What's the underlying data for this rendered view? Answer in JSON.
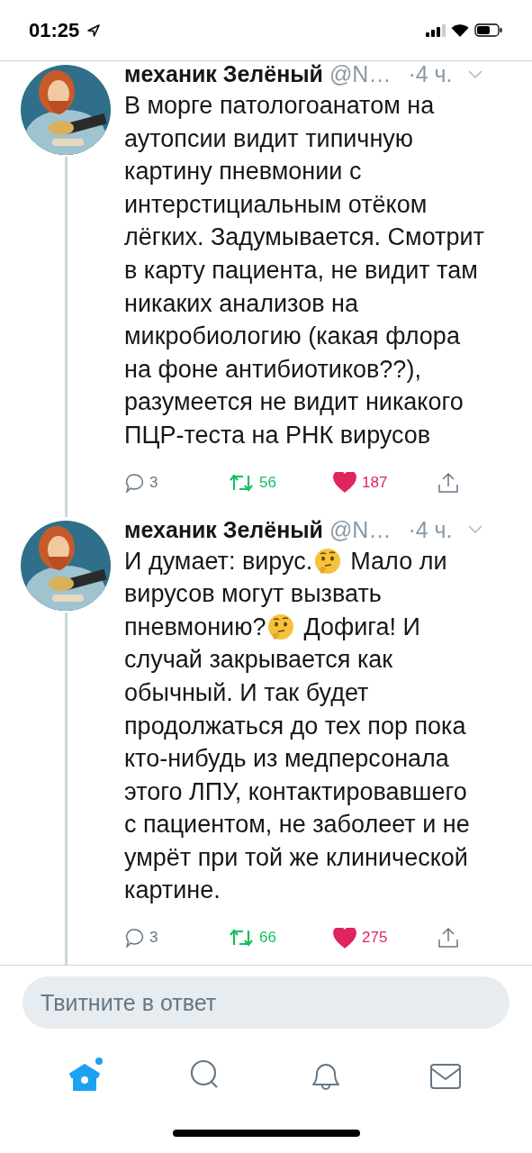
{
  "status_bar": {
    "time": "01:25"
  },
  "tweets": [
    {
      "name": "механик Зелёный",
      "handle": "@N…",
      "time": "·4 ч.",
      "lines": [
        [
          {
            "kind": "text",
            "text": "В морге патологоанатом на"
          }
        ],
        [
          {
            "kind": "text",
            "text": "аутопсии видит типичную"
          }
        ],
        [
          {
            "kind": "text",
            "text": "картину пневмонии с"
          }
        ],
        [
          {
            "kind": "text",
            "text": "интерстициальным отёком"
          }
        ],
        [
          {
            "kind": "text",
            "text": "лёгких. Задумывается. Смотрит"
          }
        ],
        [
          {
            "kind": "text",
            "text": "в карту пациента, не видит там"
          }
        ],
        [
          {
            "kind": "text",
            "text": "никаких анализов на"
          }
        ],
        [
          {
            "kind": "text",
            "text": "микробиологию (какая флора"
          }
        ],
        [
          {
            "kind": "text",
            "text": "на фоне антибиотиков??),"
          }
        ],
        [
          {
            "kind": "text",
            "text": "разумеется не видит никакого"
          }
        ],
        [
          {
            "kind": "text",
            "text": "ПЦР-теста на РНК вирусов"
          }
        ]
      ],
      "replies": "3",
      "retweets": "56",
      "likes": "187",
      "retweeted": true,
      "liked": true
    },
    {
      "name": "механик Зелёный",
      "handle": "@N…",
      "time": "·4 ч.",
      "lines": [
        [
          {
            "kind": "text",
            "text": "И думает: вирус."
          },
          {
            "kind": "emoji"
          },
          {
            "kind": "text",
            "text": "Мало ли"
          }
        ],
        [
          {
            "kind": "text",
            "text": "вирусов могут вызвать"
          }
        ],
        [
          {
            "kind": "text",
            "text": "пневмонию?"
          },
          {
            "kind": "emoji"
          },
          {
            "kind": "text",
            "text": "Дофига! И"
          }
        ],
        [
          {
            "kind": "text",
            "text": "случай закрывается как"
          }
        ],
        [
          {
            "kind": "text",
            "text": "обычный. И так будет"
          }
        ],
        [
          {
            "kind": "text",
            "text": "продолжаться до тех пор пока"
          }
        ],
        [
          {
            "kind": "text",
            "text": "кто-нибудь из медперсонала"
          }
        ],
        [
          {
            "kind": "text",
            "text": "этого ЛПУ, контактировавшего"
          }
        ],
        [
          {
            "kind": "text",
            "text": "с пациентом, не заболеет и не"
          }
        ],
        [
          {
            "kind": "text",
            "text": "умрёт при той же клинической"
          }
        ],
        [
          {
            "kind": "text",
            "text": "картине."
          }
        ]
      ],
      "replies": "3",
      "retweets": "66",
      "likes": "275",
      "retweeted": true,
      "liked": true
    }
  ],
  "reply_field": {
    "placeholder": "Твитните в ответ"
  },
  "tabs": [
    {
      "kind": "home",
      "selected": true,
      "new": true
    },
    {
      "kind": "search",
      "selected": false,
      "new": false
    },
    {
      "kind": "notifications",
      "selected": false,
      "new": false
    },
    {
      "kind": "messages",
      "selected": false,
      "new": false
    }
  ]
}
